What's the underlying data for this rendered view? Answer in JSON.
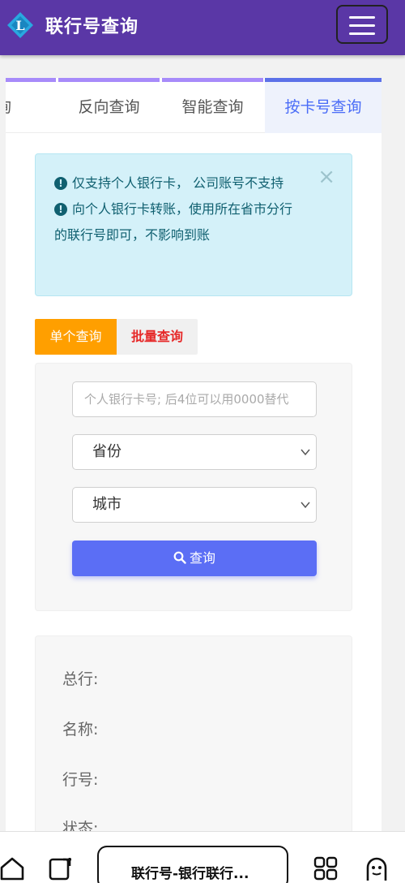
{
  "header": {
    "logo_letter": "L",
    "title": "联行号查询",
    "menu_icon": "hamburger-icon"
  },
  "tabs": [
    {
      "label": "询",
      "active": false
    },
    {
      "label": "反向查询",
      "active": false
    },
    {
      "label": "智能查询",
      "active": false
    },
    {
      "label": "按卡号查询",
      "active": true
    }
  ],
  "alert": {
    "line1": "仅支持个人银行卡， 公司账号不支持",
    "line2": "向个人银行卡转账，使用所在省市分行的联行号即可，不影响到账",
    "close": "×"
  },
  "mode": {
    "single": "单个查询",
    "batch": "批量查询"
  },
  "form": {
    "card_placeholder": "个人银行卡号; 后4位可以用0000替代",
    "card_value": "",
    "province": "省份",
    "city": "城市",
    "query_button": "查询"
  },
  "results": {
    "head_office": "总行:",
    "name": "名称:",
    "bank_no": "行号:",
    "status": "状态:"
  },
  "bottom_bar": {
    "tab_title": "联行号-银行联行...",
    "icons": [
      "home-icon",
      "tab-switch-icon",
      "apps-grid-icon",
      "ghost-icon"
    ]
  },
  "colors": {
    "header_bg": "#5a37a6",
    "accent": "#5b6ef5",
    "single_mode": "#ff9f00",
    "batch_text": "#e62828",
    "alert_bg": "#d4f1f9"
  }
}
